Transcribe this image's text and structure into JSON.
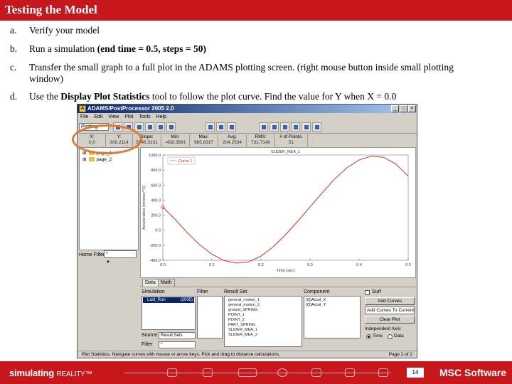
{
  "slide": {
    "title": "Testing the Model",
    "steps": [
      {
        "label": "a.",
        "parts": [
          {
            "text": "Verify your model",
            "bold": false
          }
        ]
      },
      {
        "label": "b.",
        "parts": [
          {
            "text": "Run a simulation ",
            "bold": false
          },
          {
            "text": "(end time = 0.5, steps = 50)",
            "bold": true
          }
        ]
      },
      {
        "label": "c.",
        "parts": [
          {
            "text": "Transfer the small graph to a full plot in the ADAMS plotting screen. (right mouse button inside small plotting window)",
            "bold": false
          }
        ]
      },
      {
        "label": "d.",
        "parts": [
          {
            "text": "Use the ",
            "bold": false
          },
          {
            "text": "Display Plot Statistics",
            "bold": true
          },
          {
            "text": " tool to follow the plot curve. Find the value for Y when X = 0.0",
            "bold": false
          }
        ]
      }
    ]
  },
  "window": {
    "title": "ADAMS/PostProcessor 2005 2.0",
    "menu": [
      "File",
      "Edit",
      "View",
      "Plot",
      "Tools",
      "Help"
    ],
    "mode": "Plotting",
    "toolbar_icons": [
      "undo-icon",
      "redo-icon",
      "select-icon",
      "zoom-icon",
      "fit-icon",
      "stats-icon",
      "new-page-icon",
      "prev-page-icon",
      "next-page-icon",
      "layout-1-icon",
      "layout-2-icon",
      "layout-4-icon",
      "animation-icon",
      "report-icon",
      "plot-icon"
    ],
    "stats": [
      {
        "label": "X:",
        "value": "0.0"
      },
      {
        "label": "Y:",
        "value": "306.2114"
      },
      {
        "label": "Slope:",
        "value": "5646.3101"
      },
      {
        "label": "Min:",
        "value": "-438.3891"
      },
      {
        "label": "Max:",
        "value": "985.6317"
      },
      {
        "label": "Avg:",
        "value": "204.2534"
      },
      {
        "label": "RMS:",
        "value": "731.7146"
      },
      {
        "label": "# of Points:",
        "value": "51"
      }
    ],
    "tree": [
      "page_1",
      "page_2"
    ],
    "home_filter_label": "Home Filter",
    "home_filter_value": "*",
    "tabs": [
      "Data",
      "Math"
    ],
    "browser": {
      "simulation_label": "Simulation",
      "simulation_item": "Last_Run",
      "simulation_tag": "(2005)",
      "filter_label": "Filter",
      "result_set_label": "Result Set",
      "result_sets": [
        "general_motion_1",
        "general_motion_2",
        "ground_SPRING",
        "POINT_1",
        "POINT_2",
        "PART_SPRING",
        "SLIDER_MEA_1",
        "SLIDER_MEA_2"
      ],
      "component_label": "Component",
      "components": [
        "(Q)Accel_X",
        "(Q)Accel_Y"
      ],
      "surf_label": "Surf",
      "add_curves": "Add Curves",
      "add_select": "Add Curves To Current",
      "clear_plot": "Clear Plot",
      "independent_axis": "Independent Axis:",
      "radio_time": "Time",
      "radio_data": "Data",
      "source_label": "Source",
      "source_value": "Result Sets",
      "filter2_label": "Filter",
      "filter2_value": "*"
    },
    "status": "Plot Statistics. Navigate curves with mouse or arrow keys. Pick and drag to distance calculations.",
    "page": "Page  2  of  2"
  },
  "chart_data": {
    "type": "line",
    "title": "SLIDER_MEA_1",
    "legend": [
      "Curve 1"
    ],
    "xlabel": "Time (sec)",
    "ylabel": "Acceleration (mm/sec**2)",
    "xlim": [
      0.0,
      0.5
    ],
    "ylim": [
      -400.0,
      1000.0
    ],
    "x_ticks": [
      "0.0",
      "0.1",
      "0.2",
      "0.3",
      "0.4",
      "0.5"
    ],
    "y_ticks": [
      "1000.0",
      "800.0",
      "600.0",
      "400.0",
      "200.0",
      "0.0",
      "-200.0",
      "-400.0"
    ],
    "series": [
      {
        "name": "Curve 1",
        "color": "#e03020",
        "x": [
          0.0,
          0.025,
          0.05,
          0.075,
          0.1,
          0.125,
          0.15,
          0.175,
          0.2,
          0.225,
          0.25,
          0.275,
          0.3,
          0.325,
          0.35,
          0.375,
          0.4,
          0.425,
          0.45,
          0.475,
          0.5
        ],
        "y": [
          306,
          145,
          -35,
          -195,
          -320,
          -405,
          -438,
          -420,
          -345,
          -220,
          -60,
          120,
          310,
          500,
          680,
          830,
          935,
          985,
          970,
          880,
          720
        ]
      }
    ]
  },
  "footer": {
    "brand": "simulating",
    "brand_sub": "REALITY™",
    "page_number": "14",
    "logo": "MSC Software"
  }
}
